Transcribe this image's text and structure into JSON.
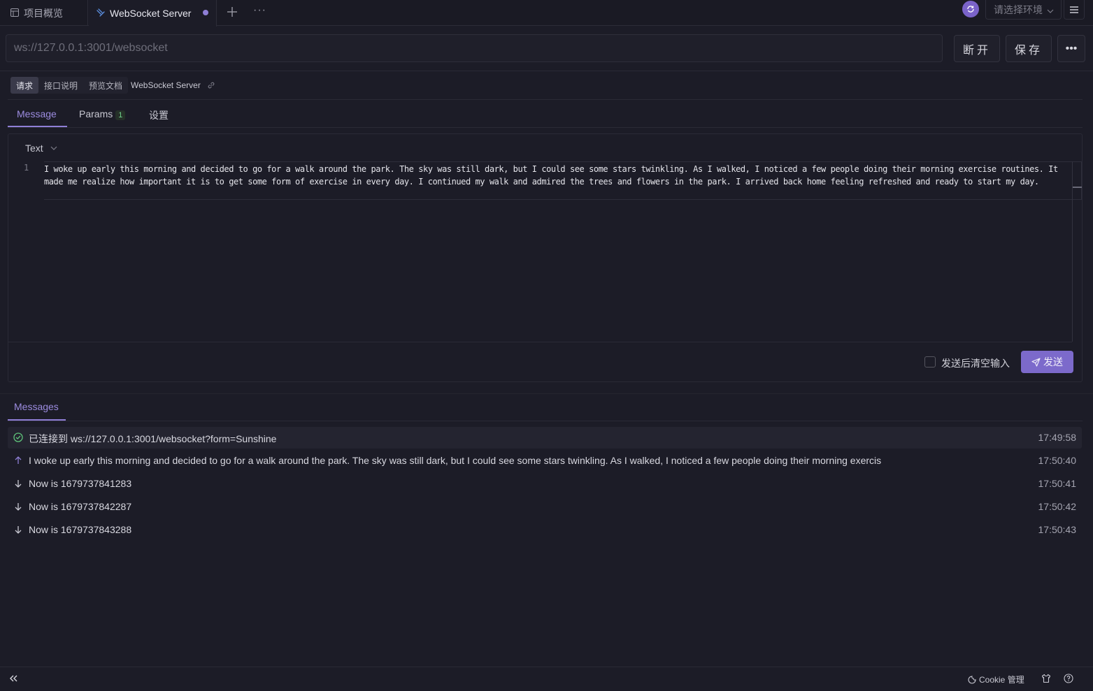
{
  "tabs": {
    "overview_label": "项目概览",
    "active_label": "WebSocket Server",
    "more_symbol": "···"
  },
  "header": {
    "env_placeholder": "请选择环境"
  },
  "request": {
    "url": "ws://127.0.0.1:3001/websocket",
    "disconnect_label": "断开",
    "save_label": "保存",
    "more_symbol": "•••"
  },
  "modes": {
    "items": [
      "请求",
      "接口说明",
      "预览文档"
    ],
    "api_name": "WebSocket Server"
  },
  "subtabs": {
    "message": "Message",
    "params": "Params",
    "params_count": "1",
    "settings": "设置"
  },
  "editor": {
    "type": "Text",
    "line_number": "1",
    "content": "I woke up early this morning and decided to go for a walk around the park. The sky was still dark, but I could see some stars twinkling. As I walked, I noticed a few people doing their morning exercise routines. It made me realize how important it is to get some form of exercise in every day. I continued my walk and admired the trees and flowers in the park. I arrived back home feeling refreshed and ready to start my day.",
    "clear_after_send": "发送后清空输入",
    "send_label": "发送"
  },
  "messages": {
    "tab_label": "Messages",
    "items": [
      {
        "kind": "connected",
        "text": "已连接到 ws://127.0.0.1:3001/websocket?form=Sunshine",
        "time": "17:49:58"
      },
      {
        "kind": "sent",
        "text": "I woke up early this morning and decided to go for a walk around the park. The sky was still dark, but I could see some stars twinkling. As I walked, I noticed a few people doing their morning exercis",
        "time": "17:50:40"
      },
      {
        "kind": "received",
        "text": "Now is 1679737841283",
        "time": "17:50:41"
      },
      {
        "kind": "received",
        "text": "Now is 1679737842287",
        "time": "17:50:42"
      },
      {
        "kind": "received",
        "text": "Now is 1679737843288",
        "time": "17:50:43"
      }
    ]
  },
  "footer": {
    "cookie_label": "Cookie 管理"
  },
  "colors": {
    "accent": "#8f7fd6",
    "send_button": "#7c6acb",
    "connected": "#5fc47a",
    "background": "#1c1c27"
  }
}
